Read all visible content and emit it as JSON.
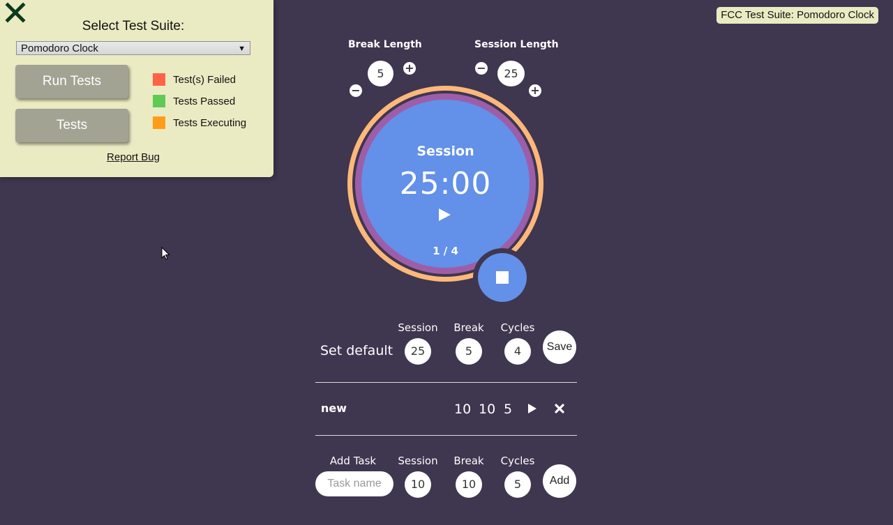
{
  "fcc": {
    "suite_title": "Select Test Suite:",
    "suite_selected": "Pomodoro Clock",
    "run_tests_label": "Run Tests",
    "tests_label": "Tests",
    "legend": [
      {
        "label": "Test(s) Failed",
        "color": "#ff6347"
      },
      {
        "label": "Tests Passed",
        "color": "#5fcb55"
      },
      {
        "label": "Tests Executing",
        "color": "#ff9c1a"
      }
    ],
    "report_bug": "Report Bug",
    "badge": "FCC Test Suite: Pomodoro Clock"
  },
  "pomodoro": {
    "break_label": "Break Length",
    "session_label": "Session Length",
    "break_value": "5",
    "session_value": "25",
    "timer_label": "Session",
    "timer_time": "25:00",
    "cycle": "1 / 4"
  },
  "defaults": {
    "title": "Set default",
    "session_head": "Session",
    "break_head": "Break",
    "cycles_head": "Cycles",
    "session": "25",
    "break": "5",
    "cycles": "4",
    "save_label": "Save"
  },
  "tasks": [
    {
      "name": "new",
      "session": "10",
      "break": "10",
      "cycles": "5"
    }
  ],
  "add_task": {
    "title": "Add Task",
    "session_head": "Session",
    "break_head": "Break",
    "cycles_head": "Cycles",
    "placeholder": "Task name",
    "session": "10",
    "break": "10",
    "cycles": "5",
    "add_label": "Add"
  },
  "colors": {
    "background": "#3f364f",
    "clock_face": "#6390e8",
    "ring_orange": "#fcb87a",
    "ring_purple": "#9d5ea9",
    "panel": "#ebebc3"
  }
}
